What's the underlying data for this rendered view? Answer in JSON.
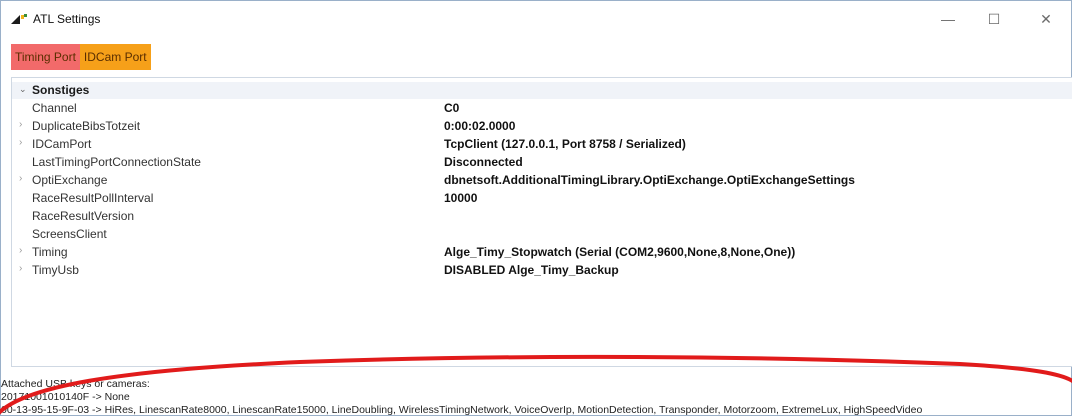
{
  "window": {
    "title": "ATL Settings",
    "icon": "atl-app-icon"
  },
  "window_controls": {
    "minimize": "—",
    "maximize": "☐",
    "close": "✕"
  },
  "tabs": [
    {
      "label": "Timing Port",
      "color": "#f26a6a"
    },
    {
      "label": "IDCam Port",
      "color": "#f6a019"
    }
  ],
  "property_grid": {
    "category": "Sonstiges",
    "rows": [
      {
        "name": "Channel",
        "value": "C0",
        "expandable": false
      },
      {
        "name": "DuplicateBibsTotzeit",
        "value": "0:00:02.0000",
        "expandable": true
      },
      {
        "name": "IDCamPort",
        "value": "TcpClient (127.0.0.1, Port 8758 / Serialized)",
        "expandable": true
      },
      {
        "name": "LastTimingPortConnectionState",
        "value": "Disconnected",
        "expandable": false
      },
      {
        "name": "OptiExchange",
        "value": "dbnetsoft.AdditionalTimingLibrary.OptiExchange.OptiExchangeSettings",
        "expandable": true
      },
      {
        "name": "RaceResultPollInterval",
        "value": "10000",
        "expandable": false
      },
      {
        "name": "RaceResultVersion",
        "value": "",
        "expandable": false
      },
      {
        "name": "ScreensClient",
        "value": "",
        "expandable": false
      },
      {
        "name": "Timing",
        "value": "Alge_Timy_Stopwatch (Serial (COM2,9600,None,8,None,One))",
        "expandable": true
      },
      {
        "name": "TimyUsb",
        "value": "DISABLED Alge_Timy_Backup",
        "expandable": true
      }
    ]
  },
  "status_lines": [
    "Attached USB keys or cameras:",
    "20171001010140F -> None",
    "00-13-95-15-9F-03 -> HiRes, LinescanRate8000, LinescanRate15000, LineDoubling, WirelessTimingNetwork, VoiceOverIp, MotionDetection, Transponder, Motorzoom, ExtremeLux, HighSpeedVideo"
  ],
  "annotation_color": "#e11b1b"
}
